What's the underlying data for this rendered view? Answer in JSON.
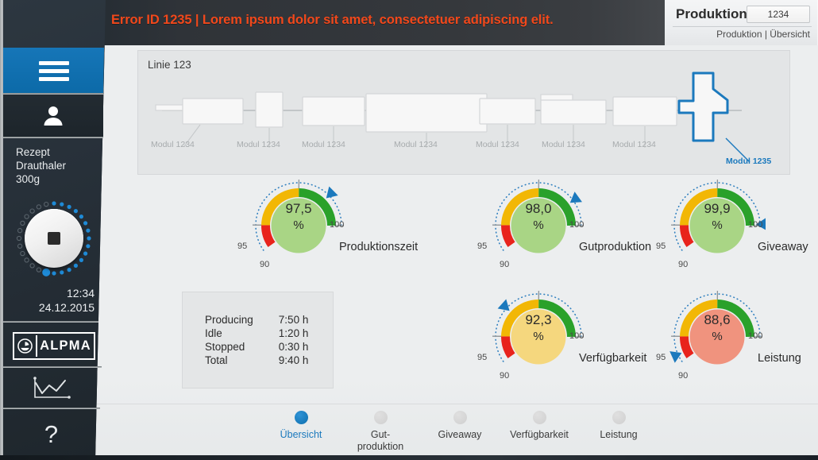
{
  "topbar": {
    "warning_icon": "warning-triangle-icon",
    "error_text": "Error ID 1235 | Lorem ipsum dolor sit amet, consectetuer adipiscing elit.",
    "error_color": "#f1481b",
    "title": "Produktion",
    "number": "1234",
    "breadcrumb": "Produktion | Übersicht"
  },
  "sidebar": {
    "menu_icon": "hamburger-menu-icon",
    "user_icon": "user-person-icon",
    "recipe": {
      "line1": "Rezept",
      "line2": "Drauthaler",
      "line3": "300g"
    },
    "dial": {
      "icon": "stop-square-icon",
      "progress_pct": 58
    },
    "time": "12:34",
    "date": "24.12.2015",
    "logo": {
      "mark": "alpma-emblem-icon",
      "text": "ALPMA"
    },
    "chart_icon": "line-chart-icon",
    "help_label": "?"
  },
  "line_panel": {
    "title": "Linie 123",
    "modules": [
      {
        "label": "Modul 1234",
        "highlight": false
      },
      {
        "label": "Modul 1234",
        "highlight": false
      },
      {
        "label": "Modul 1234",
        "highlight": false
      },
      {
        "label": "Modul 1234",
        "highlight": false
      },
      {
        "label": "Modul 1234",
        "highlight": false
      },
      {
        "label": "Modul 1234",
        "highlight": false
      },
      {
        "label": "Modul 1234",
        "highlight": false
      },
      {
        "label": "Modul 1235",
        "highlight": true
      }
    ],
    "highlight_color": "#1b79bd"
  },
  "gauges": [
    {
      "name": "Produktionszeit",
      "value": "97,5",
      "unit": "%",
      "value_num": 97.5,
      "fill": "#a9d585",
      "tick_high": "100",
      "tick_mid": "95",
      "tick_low": "90"
    },
    {
      "name": "Gutproduktion",
      "value": "98,0",
      "unit": "%",
      "value_num": 98.0,
      "fill": "#a9d585",
      "tick_high": "100",
      "tick_mid": "95",
      "tick_low": "90"
    },
    {
      "name": "Giveaway",
      "value": "99,9",
      "unit": "%",
      "value_num": 99.9,
      "fill": "#a9d585",
      "tick_high": "100",
      "tick_mid": "95",
      "tick_low": "90"
    },
    {
      "name": "Verfügbarkeit",
      "value": "92,3",
      "unit": "%",
      "value_num": 92.3,
      "fill": "#f5d77e",
      "tick_high": "100",
      "tick_mid": "95",
      "tick_low": "90"
    },
    {
      "name": "Leistung",
      "value": "88,6",
      "unit": "%",
      "value_num": 88.6,
      "fill": "#f0937e",
      "tick_high": "100",
      "tick_mid": "95",
      "tick_low": "90"
    }
  ],
  "gauge_colors": {
    "green": "#2aa12a",
    "yellow": "#f2b705",
    "red": "#e8231c",
    "pointer": "#1b79bd",
    "dotted": "#2f7fbf"
  },
  "stats": {
    "rows": [
      {
        "label": "Producing",
        "value": "7:50 h"
      },
      {
        "label": "Idle",
        "value": "1:20 h"
      },
      {
        "label": "Stopped",
        "value": "0:30 h"
      },
      {
        "label": "Total",
        "value": "9:40 h"
      }
    ]
  },
  "bottom_nav": {
    "items": [
      {
        "label": "Übersicht",
        "active": true
      },
      {
        "label": "Gut-\nproduktion",
        "active": false
      },
      {
        "label": "Giveaway",
        "active": false
      },
      {
        "label": "Verfügbarkeit",
        "active": false
      },
      {
        "label": "Leistung",
        "active": false
      }
    ]
  }
}
